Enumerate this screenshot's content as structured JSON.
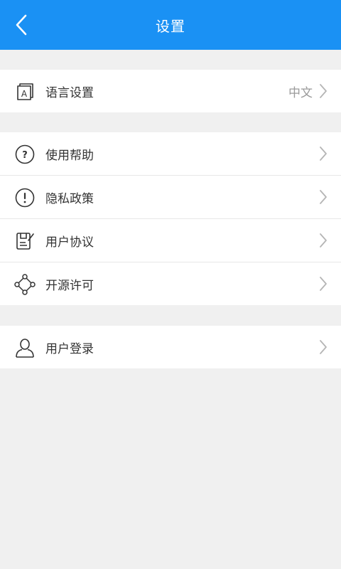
{
  "header": {
    "title": "设置",
    "back_icon": "chevron-left-icon",
    "color": "#1a91f4"
  },
  "groups": [
    {
      "items": [
        {
          "label": "语言设置",
          "value": "中文",
          "icon": "language-icon"
        }
      ]
    },
    {
      "items": [
        {
          "label": "使用帮助",
          "icon": "help-icon"
        },
        {
          "label": "隐私政策",
          "icon": "exclamation-icon"
        },
        {
          "label": "用户协议",
          "icon": "agreement-icon"
        },
        {
          "label": "开源许可",
          "icon": "open-source-icon"
        }
      ]
    },
    {
      "items": [
        {
          "label": "用户登录",
          "icon": "user-icon"
        }
      ]
    }
  ]
}
